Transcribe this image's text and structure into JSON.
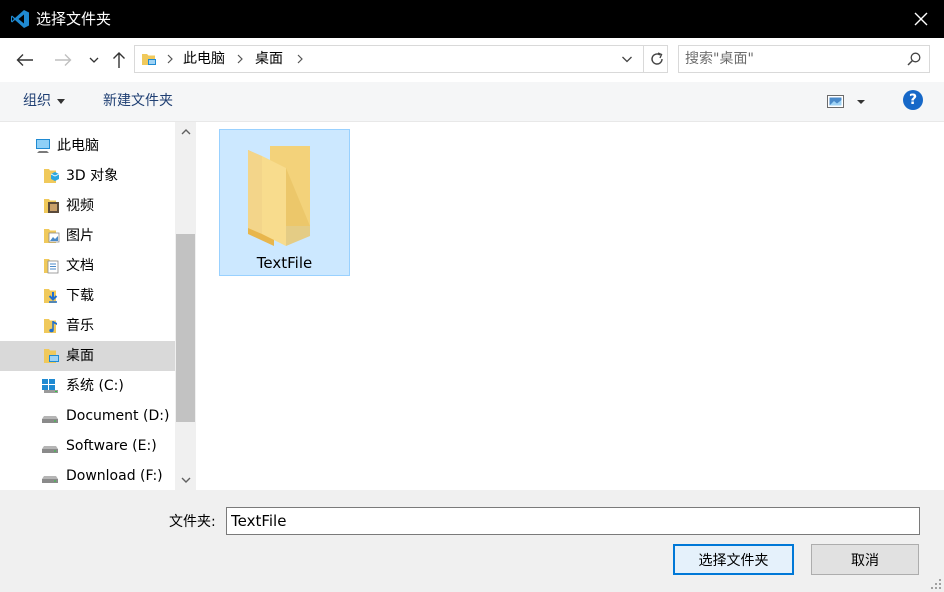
{
  "window": {
    "title": "选择文件夹",
    "app_icon": "vscode-icon",
    "close_icon": "close-icon"
  },
  "address": {
    "location_icon": "desktop-folder-icon",
    "breadcrumbs": [
      "此电脑",
      "桌面"
    ],
    "search_placeholder": "搜索\"桌面\""
  },
  "toolbar": {
    "organize_label": "组织",
    "new_folder_label": "新建文件夹",
    "help_label": "?"
  },
  "sidebar": {
    "items": [
      {
        "label": "此电脑",
        "icon": "computer-icon"
      },
      {
        "label": "3D 对象",
        "icon": "3d-objects-icon"
      },
      {
        "label": "视频",
        "icon": "videos-icon"
      },
      {
        "label": "图片",
        "icon": "pictures-icon"
      },
      {
        "label": "文档",
        "icon": "documents-icon"
      },
      {
        "label": "下载",
        "icon": "downloads-icon"
      },
      {
        "label": "音乐",
        "icon": "music-icon"
      },
      {
        "label": "桌面",
        "icon": "desktop-icon",
        "selected": true
      },
      {
        "label": "系统 (C:)",
        "icon": "windows-drive-icon"
      },
      {
        "label": "Document (D:)",
        "icon": "drive-icon"
      },
      {
        "label": "Software (E:)",
        "icon": "drive-icon"
      },
      {
        "label": "Download (F:)",
        "icon": "drive-icon"
      }
    ]
  },
  "content": {
    "items": [
      {
        "name": "TextFile",
        "icon": "folder-icon",
        "selected": true
      }
    ]
  },
  "footer": {
    "folder_label": "文件夹:",
    "folder_value": "TextFile",
    "select_button": "选择文件夹",
    "cancel_button": "取消"
  },
  "colors": {
    "titlebar": "#000000",
    "selection": "#cce8ff",
    "accent": "#0078d7"
  }
}
